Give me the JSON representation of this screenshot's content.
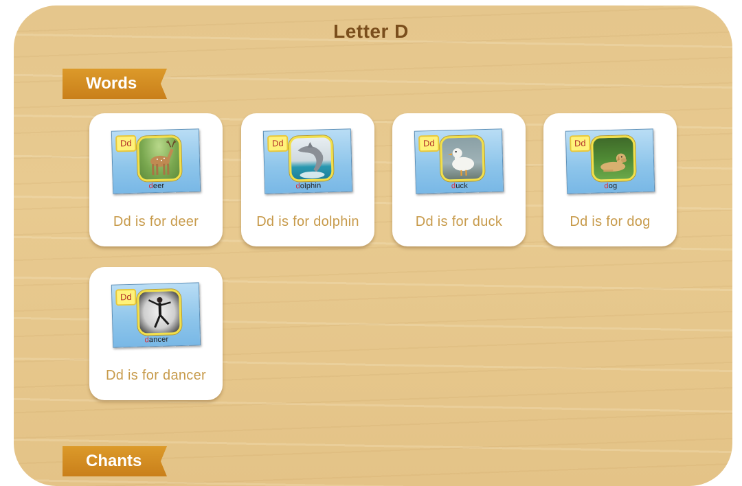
{
  "page": {
    "title": "Letter D"
  },
  "sections": {
    "words": "Words",
    "chants": "Chants"
  },
  "cards": [
    {
      "badge": "Dd",
      "word_first": "d",
      "word_rest": "eer",
      "caption": "Dd is for deer"
    },
    {
      "badge": "Dd",
      "word_first": "d",
      "word_rest": "olphin",
      "caption": "Dd is for dolphin"
    },
    {
      "badge": "Dd",
      "word_first": "d",
      "word_rest": "uck",
      "caption": "Dd is for duck"
    },
    {
      "badge": "Dd",
      "word_first": "d",
      "word_rest": "og",
      "caption": "Dd is for dog"
    },
    {
      "badge": "Dd",
      "word_first": "d",
      "word_rest": "ancer",
      "caption": "Dd is for dancer"
    }
  ]
}
